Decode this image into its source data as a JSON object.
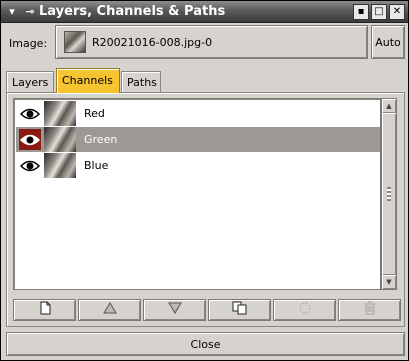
{
  "window": {
    "title": "Layers, Channels & Paths",
    "titlebar_buttons": [
      "minimize-icon",
      "maximize-icon",
      "close-icon"
    ]
  },
  "image_selector": {
    "label": "Image:",
    "value": "R20021016-008.jpg-0",
    "auto_label": "Auto"
  },
  "tabs": [
    {
      "label": "Layers",
      "active": false
    },
    {
      "label": "Channels",
      "active": true
    },
    {
      "label": "Paths",
      "active": false
    }
  ],
  "channels": [
    {
      "name": "Red",
      "visible": true,
      "selected": false
    },
    {
      "name": "Green",
      "visible": true,
      "selected": true
    },
    {
      "name": "Blue",
      "visible": true,
      "selected": false
    }
  ],
  "actions": [
    {
      "icon": "new-channel-icon",
      "enabled": true
    },
    {
      "icon": "raise-channel-icon",
      "enabled": true
    },
    {
      "icon": "lower-channel-icon",
      "enabled": true
    },
    {
      "icon": "duplicate-channel-icon",
      "enabled": true
    },
    {
      "icon": "channel-to-selection-icon",
      "enabled": false
    },
    {
      "icon": "delete-channel-icon",
      "enabled": false
    }
  ],
  "footer": {
    "close_label": "Close"
  },
  "colors": {
    "active_tab": "#f7c431",
    "selected_row": "#9b9895",
    "eye_selected_bg": "#8b1a12"
  }
}
